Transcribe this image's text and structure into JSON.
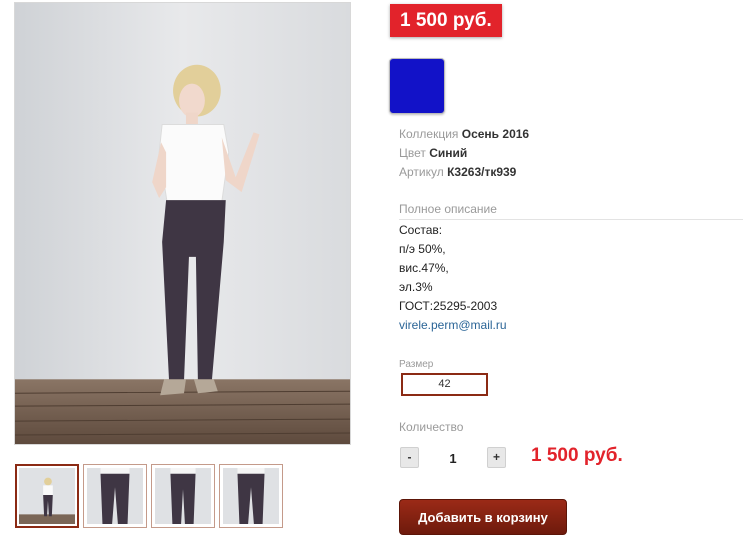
{
  "product": {
    "price_badge": "1 500 руб.",
    "color_swatch_hex": "#1212c8",
    "attributes": [
      {
        "label": "Коллекция",
        "value": "Осень 2016"
      },
      {
        "label": "Цвет",
        "value": "Синий"
      },
      {
        "label": "Артикул",
        "value": "К3263/тк939"
      }
    ],
    "description": {
      "title": "Полное описание",
      "lines": [
        "Состав:",
        "п/э 50%,",
        "вис.47%,",
        "эл.3%",
        "ГОСТ:25295-2003"
      ],
      "email": "virele.perm@mail.ru"
    },
    "size": {
      "label": "Размер",
      "selected": "42"
    },
    "quantity": {
      "label": "Количество",
      "minus": "-",
      "value": "1",
      "plus": "+"
    },
    "total_price": "1 500 руб.",
    "add_to_cart": "Добавить в корзину"
  },
  "gallery": {
    "main_image": "model-photo",
    "thumbnails": [
      "thumb-full-figure",
      "thumb-pants-front",
      "thumb-pants-side",
      "thumb-pants-back"
    ],
    "active_thumbnail": 0
  },
  "colors": {
    "accent_red": "#e2232b",
    "button_brown": "#8b2a14",
    "link_blue": "#2a6496"
  }
}
